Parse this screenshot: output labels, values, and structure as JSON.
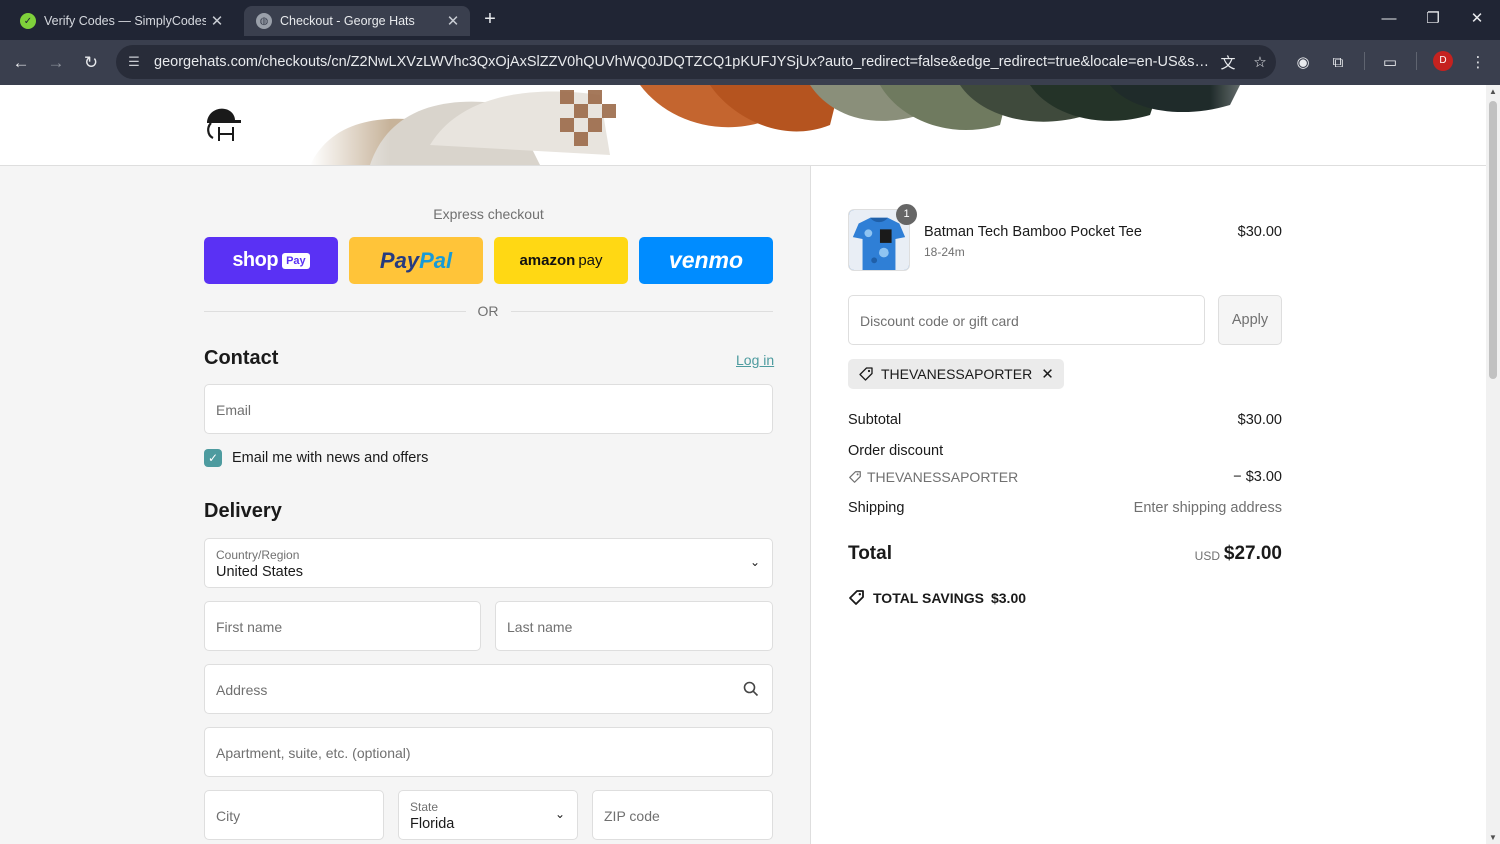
{
  "browser": {
    "tabs": [
      {
        "title": "Verify Codes — SimplyCodes",
        "favicon": "simplycodes-icon"
      },
      {
        "title": "Checkout - George Hats",
        "favicon": "globe-icon"
      }
    ],
    "url": "georgehats.com/checkouts/cn/Z2NwLXVzLWVhc3QxOjAxSlZZV0hQUVhWQ0JDQTZCQ1pKUFJYSjUx?auto_redirect=false&edge_redirect=true&locale=en-US&skip_shop_pay...",
    "profile_initial": "D"
  },
  "express": {
    "label": "Express checkout",
    "buttons": {
      "shop": {
        "word": "shop",
        "badge": "Pay"
      },
      "paypal": {
        "part1": "Pay",
        "part2": "Pal"
      },
      "amazon": {
        "word": "amazon",
        "suffix": "pay"
      },
      "venmo": {
        "word": "venmo"
      }
    },
    "or_text": "OR"
  },
  "contact": {
    "title": "Contact",
    "login_link": "Log in",
    "email_placeholder": "Email",
    "newsletter_label": "Email me with news and offers",
    "newsletter_checked": true
  },
  "delivery": {
    "title": "Delivery",
    "country_label": "Country/Region",
    "country_value": "United States",
    "first_name_placeholder": "First name",
    "last_name_placeholder": "Last name",
    "address_placeholder": "Address",
    "apartment_placeholder": "Apartment, suite, etc. (optional)",
    "city_placeholder": "City",
    "state_label": "State",
    "state_value": "Florida",
    "zip_placeholder": "ZIP code"
  },
  "summary": {
    "item": {
      "name": "Batman Tech Bamboo Pocket Tee",
      "variant": "18-24m",
      "price": "$30.00",
      "quantity": "1"
    },
    "discount_placeholder": "Discount code or gift card",
    "apply_label": "Apply",
    "applied_code": "THEVANESSAPORTER",
    "subtotal_label": "Subtotal",
    "subtotal_value": "$30.00",
    "order_discount_label": "Order discount",
    "order_discount_code": "THEVANESSAPORTER",
    "order_discount_value": "− $3.00",
    "shipping_label": "Shipping",
    "shipping_value": "Enter shipping address",
    "total_label": "Total",
    "total_currency": "USD",
    "total_value": "$27.00",
    "savings_label": "TOTAL SAVINGS",
    "savings_value": "$3.00"
  },
  "colors": {
    "accent": "#4d9b9f",
    "shop_pay": "#5a31f4",
    "paypal": "#ffc439",
    "amazon_pay": "#ffd814",
    "venmo": "#008cff"
  }
}
